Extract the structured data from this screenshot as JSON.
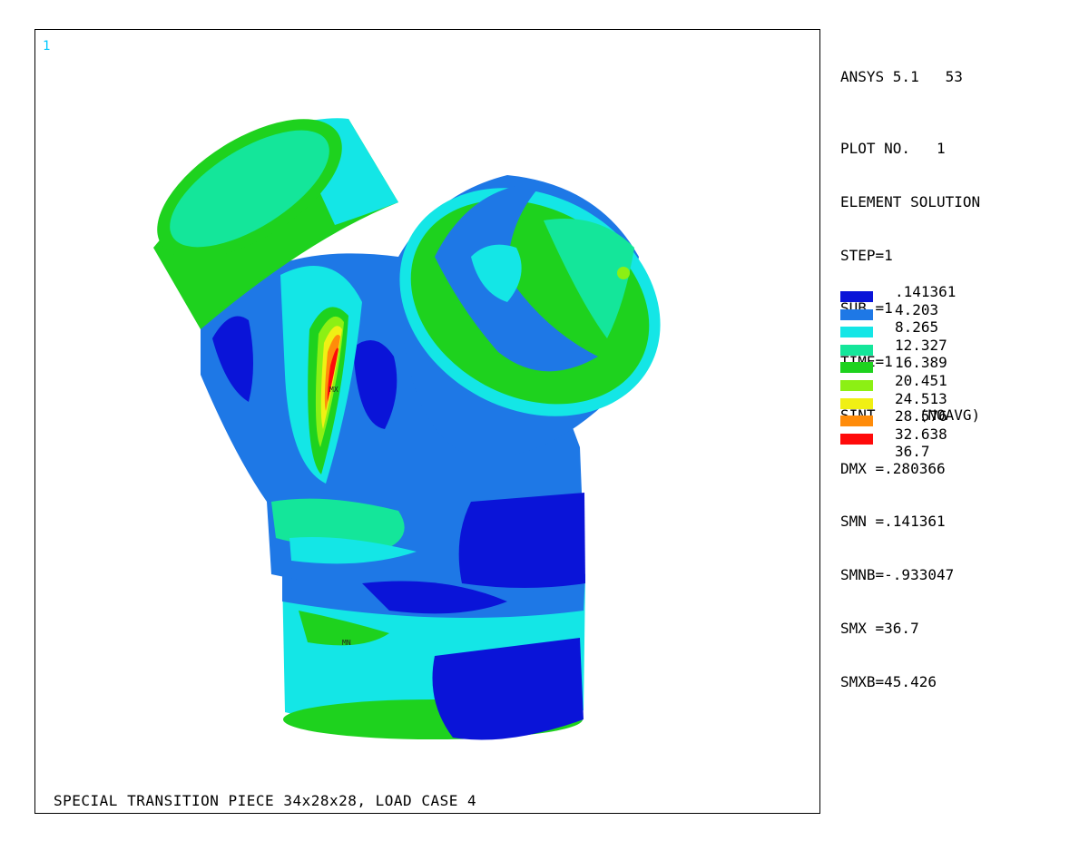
{
  "window_number": "1",
  "caption": "SPECIAL TRANSITION PIECE 34x28x28, LOAD CASE 4",
  "info": {
    "version": "ANSYS 5.1   53",
    "lines": [
      "PLOT NO.   1",
      "ELEMENT SOLUTION",
      "STEP=1",
      "SUB =1",
      "TIME=1",
      "SINT     (NOAVG)",
      "DMX =.280366",
      "SMN =.141361",
      "SMNB=-.933047",
      "SMX =36.7",
      "SMXB=45.426"
    ]
  },
  "legend": {
    "levels": [
      ".141361",
      "4.203",
      "8.265",
      "12.327",
      "16.389",
      "20.451",
      "24.513",
      "28.576",
      "32.638",
      "36.7"
    ],
    "colors": [
      "#0a14d8",
      "#1e78e6",
      "#14e6e6",
      "#14e69a",
      "#1ed21e",
      "#8cf014",
      "#f0f014",
      "#ff8c0a",
      "#ff0a0a"
    ]
  },
  "markers": {
    "max": "MX",
    "min": "MN"
  },
  "colors": {
    "dark_blue": "#0a14d8",
    "blue": "#1e78e6",
    "cyan": "#14e6e6",
    "green_cyan": "#14e69a",
    "green": "#1ed21e",
    "lime": "#8cf014",
    "yellow": "#f0f014",
    "orange": "#ff8c0a",
    "red": "#ff0a0a",
    "window_number": "#00c8ff"
  }
}
